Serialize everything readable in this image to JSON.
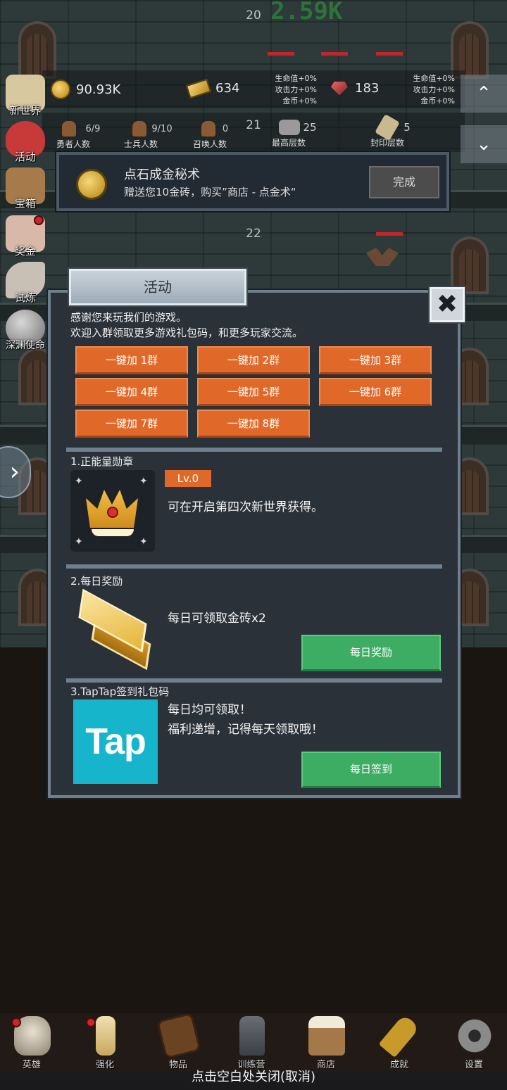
{
  "floors": {
    "top": "20",
    "mid": "21",
    "lower": "22"
  },
  "damage_number": "2.59K",
  "stats": {
    "gold": "90.93K",
    "gold_bricks": "634",
    "gems": "183",
    "bonus_left": [
      "生命值+0%",
      "攻击力+0%",
      "金币+0%"
    ],
    "bonus_right": [
      "生命值+0%",
      "攻击力+0%",
      "金币+0%"
    ]
  },
  "counts": [
    {
      "value": "6/9",
      "label": "勇者人数"
    },
    {
      "value": "9/10",
      "label": "士兵人数"
    },
    {
      "value": "0",
      "label": "召唤人数"
    },
    {
      "value": "25",
      "label": "最高层数"
    },
    {
      "value": "5",
      "label": "封印层数"
    }
  ],
  "side_menu": [
    "新世界",
    "活动",
    "宝箱",
    "奖金",
    "试炼",
    "深渊使命"
  ],
  "quest": {
    "title": "点石成金秘术",
    "description": "赠送您10金砖，购买”商店 - 点金术“",
    "button": "完成"
  },
  "modal": {
    "title": "活动",
    "close_icon": "✖",
    "intro_lines": [
      "感谢您来玩我们的游戏。",
      "欢迎入群领取更多游戏礼包码，和更多玩家交流。"
    ],
    "group_buttons": [
      "一键加 1群",
      "一键加 2群",
      "一键加 3群",
      "一键加 4群",
      "一键加 5群",
      "一键加 6群",
      "一键加 7群",
      "一键加 8群"
    ],
    "section1": {
      "title": "1.正能量勋章",
      "level": "Lv.0",
      "text": "可在开启第四次新世界获得。"
    },
    "section2": {
      "title": "2.每日奖励",
      "text": "每日可领取金砖x2",
      "button": "每日奖励"
    },
    "section3": {
      "title": "3.TapTap签到礼包码",
      "logo": "Tap",
      "text_lines": [
        "每日均可领取！",
        "福利递增，记得每天领取哦！"
      ],
      "button": "每日签到"
    }
  },
  "bottom_nav": [
    "英雄",
    "强化",
    "物品",
    "训练营",
    "商店",
    "成就",
    "设置"
  ],
  "close_hint": "点击空白处关闭(取消)",
  "colors": {
    "orange": "#e0692a",
    "green": "#3dad63",
    "tap_blue": "#17b5cb",
    "panel": "#2a3139"
  }
}
